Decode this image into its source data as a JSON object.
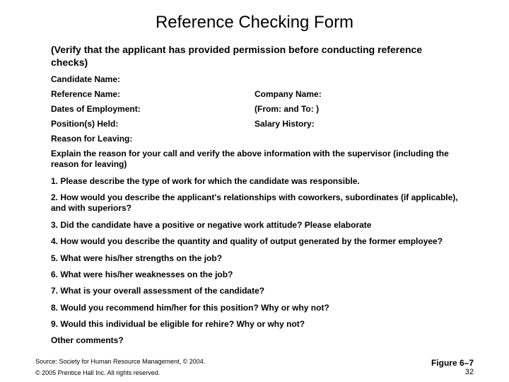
{
  "title": "Reference Checking Form",
  "instruction": "(Verify that the applicant has provided permission before conducting reference checks)",
  "fields": {
    "candidate": "Candidate Name:",
    "reference": "Reference Name:",
    "company": "Company Name:",
    "dates": "Dates of Employment:",
    "fromto": "(From: and To: )",
    "positions": "Position(s) Held:",
    "salary": "Salary History:",
    "reason": "Reason for Leaving:"
  },
  "lead": "Explain the reason for your call and verify the above information with the supervisor (including the reason for leaving)",
  "questions": [
    "1. Please describe the type of work for which the candidate was responsible.",
    "2. How would you describe the applicant's relationships with coworkers, subordinates (if applicable), and with superiors?",
    "3. Did the candidate have a positive or negative work attitude? Please elaborate",
    "4. How would you describe the quantity and quality of output generated by the former employee?",
    "5. What were his/her strengths on the job?",
    "6. What were his/her weaknesses on the job?",
    "7. What is your overall assessment of the candidate?",
    "8. Would you recommend him/her for this position? Why or why not?",
    "9. Would this individual be eligible for rehire? Why or why not?"
  ],
  "other": "Other comments?",
  "source": "Source: Society for Human Resource Management, © 2004.",
  "copyright": "© 2005 Prentice Hall Inc. All rights reserved.",
  "figure": "Figure 6–7",
  "page": "32"
}
